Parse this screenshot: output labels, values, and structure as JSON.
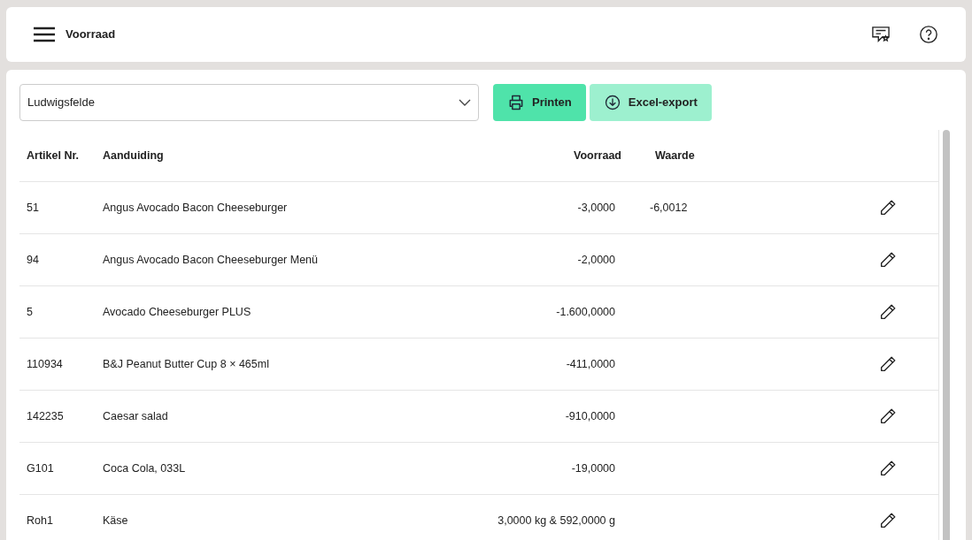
{
  "header": {
    "title": "Voorraad"
  },
  "toolbar": {
    "location": "Ludwigsfelde",
    "buttons": [
      {
        "kind": "print",
        "label": "Printen"
      },
      {
        "kind": "export",
        "label": "Excel-export"
      }
    ]
  },
  "table": {
    "columns": [
      "Artikel Nr.",
      "Aanduiding",
      "Voorraad",
      "Waarde"
    ],
    "rows": [
      {
        "article": "51",
        "name": "Angus Avocado Bacon Cheeseburger",
        "stock": "-3,0000",
        "value": "-6,0012"
      },
      {
        "article": "94",
        "name": "Angus Avocado Bacon Cheeseburger Menü",
        "stock": "-2,0000"
      },
      {
        "article": "5",
        "name": "Avocado Cheeseburger PLUS",
        "stock": "-1.600,0000"
      },
      {
        "article": "110934",
        "name": "B&J Peanut Butter Cup 8 × 465ml",
        "stock": "-411,0000"
      },
      {
        "article": "142235",
        "name": "Caesar salad",
        "stock": "-910,0000"
      },
      {
        "article": "G101",
        "name": "Coca Cola, 033L",
        "stock": "-19,0000"
      },
      {
        "article": "Roh1",
        "name": "Käse",
        "stock": "3,0000 kg & 592,0000 g"
      }
    ]
  }
}
